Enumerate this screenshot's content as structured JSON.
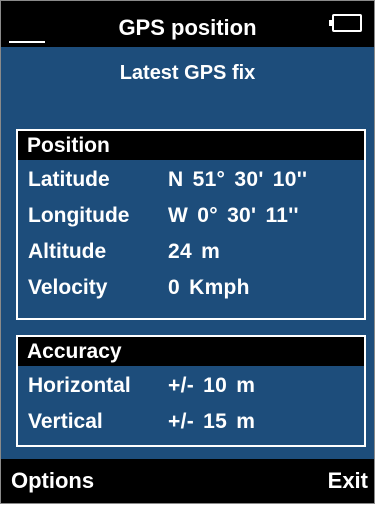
{
  "header": {
    "title": "GPS position",
    "battery_icon": "battery-icon"
  },
  "subtitle": "Latest GPS fix",
  "position": {
    "heading": "Position",
    "rows": [
      {
        "label": "Latitude",
        "value": "N  51°  30'  10''"
      },
      {
        "label": "Longitude",
        "value": "W  0°  30'  11''"
      },
      {
        "label": "Altitude",
        "value": "24   m"
      },
      {
        "label": "Velocity",
        "value": "0   Kmph"
      }
    ]
  },
  "accuracy": {
    "heading": "Accuracy",
    "rows": [
      {
        "label": "Horizontal",
        "value": "+/-  10   m"
      },
      {
        "label": "Vertical",
        "value": "+/-  15   m"
      }
    ]
  },
  "softkeys": {
    "left": "Options",
    "right": "Exit"
  },
  "colors": {
    "background": "#1d4d7b",
    "bars": "#000000",
    "text": "#ffffff"
  }
}
